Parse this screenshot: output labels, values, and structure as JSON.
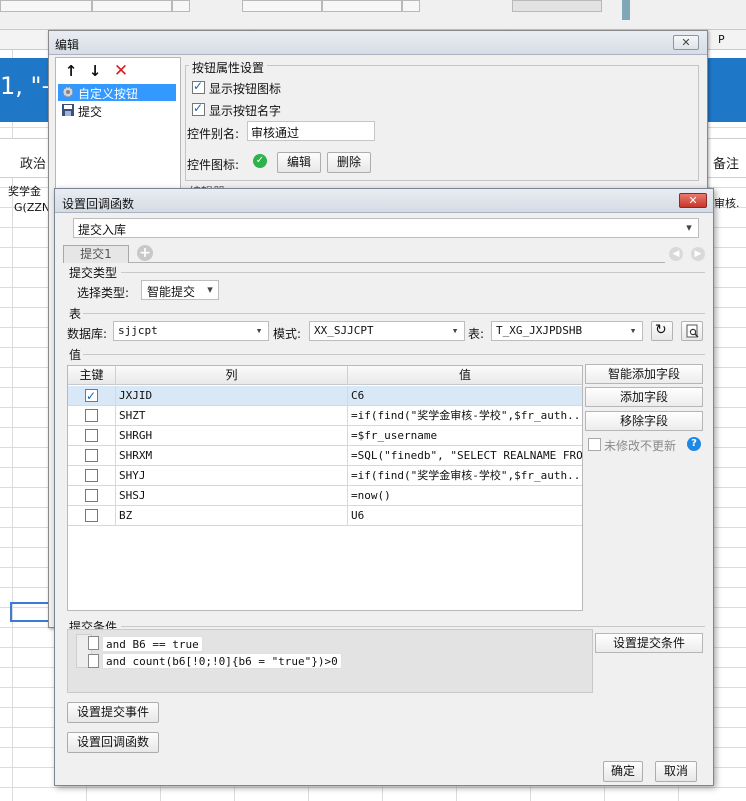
{
  "sheet": {
    "banner_text": "1, \"—",
    "header_left": "政治",
    "header_right": "备注",
    "row1_left": "奖学金",
    "row2_left": "G(ZZN",
    "row1_right": "审核.",
    "col_p": "P"
  },
  "edit_window": {
    "title": "编辑",
    "tree_items": [
      {
        "label": "自定义按钮"
      },
      {
        "label": "提交"
      }
    ],
    "prop_group_title": "按钮属性设置",
    "show_icon_label": "显示按钮图标",
    "show_name_label": "显示按钮名字",
    "alias_label": "控件别名:",
    "alias_value": "审核通过",
    "icon_label": "控件图标:",
    "edit_btn": "编辑",
    "delete_btn": "删除",
    "below_text": "编辑器"
  },
  "callback_dialog": {
    "title": "设置回调函数",
    "top_select": "提交入库",
    "tab": "提交1",
    "submit_type_section": "提交类型",
    "select_type_label": "选择类型:",
    "select_type_value": "智能提交",
    "table_section": "表",
    "db_label": "数据库:",
    "db_value": "sjjcpt",
    "schema_label": "模式:",
    "schema_value": "XX_SJJCPT",
    "table_label": "表:",
    "table_value": "T_XG_JXJPDSHB",
    "value_section": "值",
    "columns": [
      "主键",
      "列",
      "值"
    ],
    "rows": [
      {
        "key": true,
        "col": "JXJID",
        "val": "C6"
      },
      {
        "key": false,
        "col": "SHZT",
        "val": "=if(find(\"奖学金审核-学校\",$fr_auth..."
      },
      {
        "key": false,
        "col": "SHRGH",
        "val": "=$fr_username"
      },
      {
        "key": false,
        "col": "SHRXM",
        "val": "=SQL(\"finedb\", \"SELECT REALNAME FRO..."
      },
      {
        "key": false,
        "col": "SHYJ",
        "val": "=if(find(\"奖学金审核-学校\",$fr_auth..."
      },
      {
        "key": false,
        "col": "SHSJ",
        "val": "=now()"
      },
      {
        "key": false,
        "col": "BZ",
        "val": "U6"
      }
    ],
    "smart_add_btn": "智能添加字段",
    "add_field_btn": "添加字段",
    "remove_field_btn": "移除字段",
    "no_update_label": "未修改不更新",
    "cond_section": "提交条件",
    "cond_lines": [
      "and B6 == true",
      "and count(b6[!0;!0]{b6 = \"true\"})>0"
    ],
    "set_cond_btn": "设置提交条件",
    "set_event_btn": "设置提交事件",
    "set_callback_btn": "设置回调函数",
    "ok_btn": "确定",
    "cancel_btn": "取消"
  },
  "colors": {
    "accent": "#3399ff",
    "banner": "#1f77c7",
    "close_red": "#c8352a",
    "check_green": "#2db34a"
  }
}
